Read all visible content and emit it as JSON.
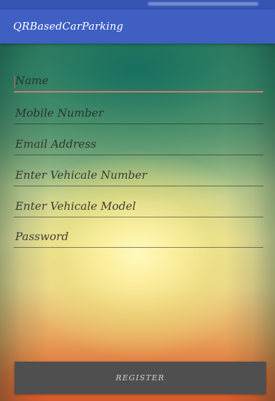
{
  "app": {
    "title": "QRBasedCarParking"
  },
  "form": {
    "fields": [
      {
        "placeholder": "Name",
        "value": ""
      },
      {
        "placeholder": "Mobile Number",
        "value": ""
      },
      {
        "placeholder": "Email Address",
        "value": ""
      },
      {
        "placeholder": "Enter Vehicale Number",
        "value": ""
      },
      {
        "placeholder": "Enter Vehicale Model",
        "value": ""
      },
      {
        "placeholder": "Password",
        "value": ""
      }
    ]
  },
  "actions": {
    "register_label": "REGISTER"
  },
  "colors": {
    "app_bar": "#3f5fc2",
    "button": "#4f4f4f",
    "focused_field_underline": "#d07d72"
  }
}
